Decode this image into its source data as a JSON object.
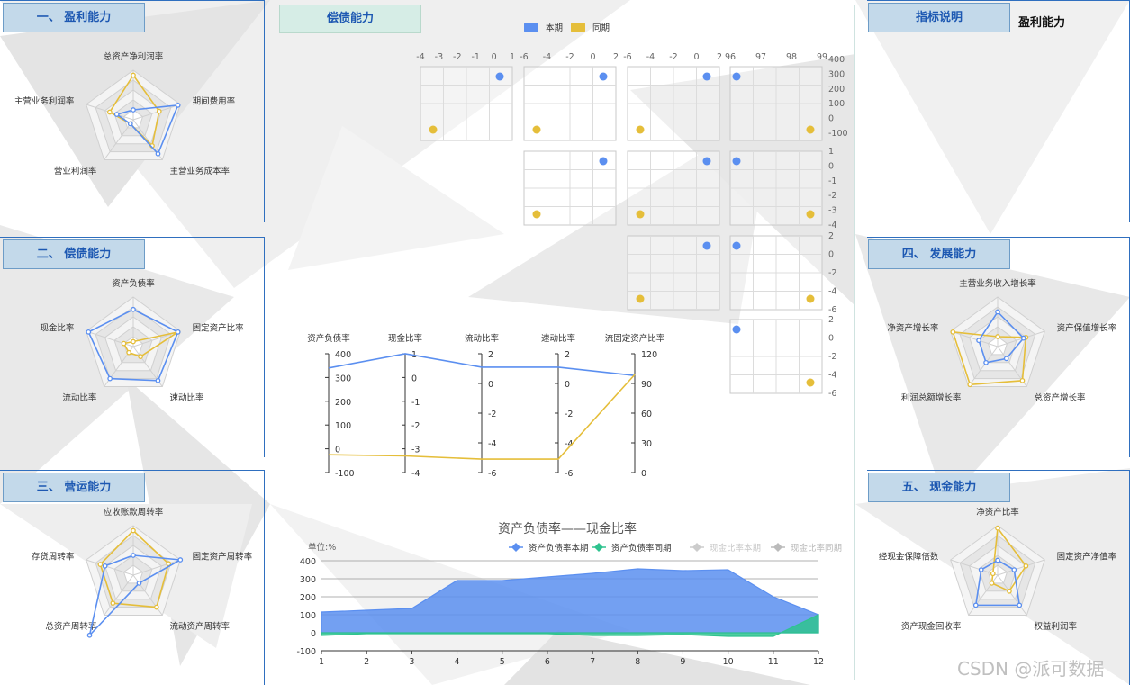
{
  "colors": {
    "current": "#5b8ff0",
    "previous": "#e5be3a",
    "prev_area": "#2fc38f",
    "accent_blue": "#1d58b2"
  },
  "panels": {
    "profit": {
      "title": "一、  盈利能力",
      "axes": [
        "总资产净利润率",
        "期间费用率",
        "主营业务成本率",
        "营业利润率",
        "主营业务利润率"
      ],
      "current": [
        0.2,
        0.95,
        0.85,
        0.1,
        0.35
      ],
      "previous": [
        0.9,
        0.55,
        0.65,
        0.1,
        0.5
      ]
    },
    "solvency": {
      "title": "二、  偿债能力",
      "axes": [
        "资产负债率",
        "固定资产比率",
        "速动比率",
        "流动比率",
        "现金比率"
      ],
      "current": [
        0.75,
        0.95,
        0.85,
        0.8,
        0.95
      ],
      "previous": [
        0.1,
        0.95,
        0.25,
        0.15,
        0.2
      ]
    },
    "operation": {
      "title": "三、  营运能力",
      "axes": [
        "应收账款周转率",
        "固定资产周转率",
        "流动资产周转率",
        "总资产周转率",
        "存货周转率"
      ],
      "current": [
        0.4,
        1.0,
        0.2,
        1.5,
        0.6
      ],
      "previous": [
        0.9,
        0.75,
        0.8,
        0.7,
        0.7
      ]
    },
    "growth": {
      "title": "四、  发展能力",
      "axes": [
        "主营业务收入增长率",
        "资产保值增长率",
        "总资产增长率",
        "利润总额增长率",
        "净资产增长率"
      ],
      "current": [
        0.7,
        0.55,
        0.3,
        0.4,
        0.4
      ],
      "previous": [
        0.2,
        0.6,
        0.85,
        0.95,
        0.95
      ]
    },
    "cash": {
      "title": "五、  现金能力",
      "axes": [
        "净资产比率",
        "固定资产净值率",
        "权益利润率",
        "资产现金回收率",
        "经现金保障倍数"
      ],
      "current": [
        0.3,
        0.35,
        0.75,
        0.75,
        0.35
      ],
      "previous": [
        0.95,
        0.6,
        0.4,
        0.2,
        0.1
      ]
    }
  },
  "indicator": {
    "title": "指标说明",
    "text": "盈利能力"
  },
  "center": {
    "title": "偿债能力"
  },
  "watermark": "CSDN @派可数据",
  "chart_data": [
    {
      "type": "scatter",
      "subtype": "scatter-matrix",
      "legend": [
        "本期",
        "同期"
      ],
      "dimensions": [
        "资产负债率",
        "现金比率",
        "流动比率",
        "速动比率",
        "流固定资产比率"
      ],
      "top_ticks": [
        [
          "-4",
          "-3",
          "-2",
          "-1",
          "0",
          "1"
        ],
        [
          "-6",
          "-4",
          "-2",
          "0",
          "2"
        ],
        [
          "-6",
          "-4",
          "-2",
          "0",
          "2"
        ],
        [
          "96",
          "97",
          "98",
          "99"
        ]
      ],
      "right_ticks": [
        [
          "400",
          "300",
          "200",
          "100",
          "0",
          "-100"
        ],
        [
          "1",
          "0",
          "-1",
          "-2",
          "-3",
          "-4"
        ],
        [
          "2",
          "0",
          "-2",
          "-4",
          "-6"
        ],
        [
          "2",
          "0",
          "-2",
          "-4",
          "-6"
        ]
      ],
      "current": {
        "x": [
          1.0,
          1.0,
          1.0,
          96.2
        ],
        "y": [
          340,
          1.0,
          1.0,
          1.0
        ]
      },
      "previous": {
        "x": [
          -3.6,
          -5.7,
          -5.7,
          98.8
        ],
        "y": [
          -5,
          -3.2,
          -5.2,
          -5.2
        ]
      }
    },
    {
      "type": "line",
      "subtype": "parallel",
      "axes": [
        {
          "name": "资产负债率",
          "ticks": [
            "400",
            "300",
            "200",
            "100",
            "0",
            "-100"
          ],
          "min": -100,
          "max": 400
        },
        {
          "name": "现金比率",
          "ticks": [
            "1",
            "0",
            "-1",
            "-2",
            "-3",
            "-4"
          ],
          "min": -4,
          "max": 1
        },
        {
          "name": "流动比率",
          "ticks": [
            "2",
            "0",
            "-2",
            "-4",
            "-6"
          ],
          "min": -6,
          "max": 2
        },
        {
          "name": "速动比率",
          "ticks": [
            "2",
            "0",
            "-2",
            "-4",
            "-6"
          ],
          "min": -6,
          "max": 2
        },
        {
          "name": "流固定资产比率",
          "ticks": [
            "120",
            "90",
            "60",
            "30",
            "0"
          ],
          "min": 0,
          "max": 120
        }
      ],
      "series": [
        {
          "name": "本期",
          "values": [
            340,
            1.0,
            1.1,
            1.1,
            98
          ]
        },
        {
          "name": "同期",
          "values": [
            -25,
            -3.3,
            -5.1,
            -5.1,
            99
          ]
        }
      ]
    },
    {
      "type": "area",
      "title": "资产负债率——现金比率",
      "unit": "单位:%",
      "categories": [
        "1",
        "2",
        "3",
        "4",
        "5",
        "6",
        "7",
        "8",
        "9",
        "10",
        "11",
        "12"
      ],
      "ylim": [
        -100,
        400
      ],
      "yticks": [
        "400",
        "300",
        "200",
        "100",
        "0",
        "-100"
      ],
      "series": [
        {
          "name": "资产负债率本期",
          "values": [
            115,
            125,
            135,
            290,
            290,
            310,
            330,
            355,
            345,
            350,
            200,
            100
          ]
        },
        {
          "name": "资产负债率同期",
          "values": [
            -15,
            -5,
            -5,
            -5,
            -5,
            -5,
            -15,
            -15,
            -10,
            -20,
            -20,
            100
          ]
        },
        {
          "name": "现金比率本期",
          "values": []
        },
        {
          "name": "现金比率同期",
          "values": []
        }
      ],
      "legend": [
        "资产负债率本期",
        "资产负债率同期",
        "现金比率本期",
        "现金比率同期"
      ]
    }
  ]
}
